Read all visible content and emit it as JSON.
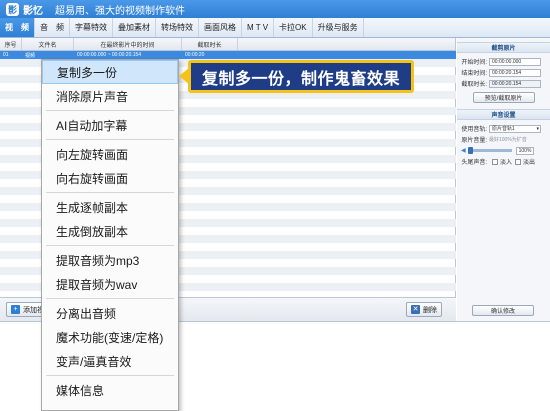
{
  "app": {
    "logo_glyph": "影",
    "name": "影忆",
    "tagline": "超易用、强大的视频制作软件"
  },
  "tabs": [
    {
      "label": "视　频",
      "active": true
    },
    {
      "label": "音　频",
      "active": false
    },
    {
      "label": "字幕特效",
      "active": false
    },
    {
      "label": "叠加素材",
      "active": false
    },
    {
      "label": "转场特效",
      "active": false
    },
    {
      "label": "画面风格",
      "active": false
    },
    {
      "label": "M T V",
      "active": false
    },
    {
      "label": "卡拉OK",
      "active": false
    },
    {
      "label": "升级与服务",
      "active": false
    }
  ],
  "table": {
    "headers": [
      "序号",
      "文件名",
      "在最终影片中的时间",
      "截取时长"
    ],
    "selected_row": {
      "index": "01",
      "name": "视频",
      "time": "00:00:00.000 ~ 00:00:20.154",
      "duration": "00:00:20"
    }
  },
  "bottombar": {
    "add_label": "添加视",
    "delete_label": "删除",
    "confirm_label": "确认修改"
  },
  "panel": {
    "clip_title": "截剪原片",
    "start_label": "开始时间:",
    "start_value": "00:00:00.000",
    "end_label": "结束时间:",
    "end_value": "00:00:20.154",
    "dur_label": "截取时长:",
    "dur_value": "00:00:20.154",
    "preview_button": "预览/截取原片",
    "audio_title": "声音设置",
    "track_label": "使用音轨:",
    "track_value": "原片音轨1",
    "volume_label": "原片音量:",
    "volume_hint": "最好100%为扩音",
    "volume_value": "100%",
    "fade_label": "头尾声音:",
    "fade_in": "淡入",
    "fade_out": "淡出"
  },
  "context_menu": {
    "groups": [
      [
        "复制多一份",
        "消除原片声音"
      ],
      [
        "AI自动加字幕"
      ],
      [
        "向左旋转画面",
        "向右旋转画面"
      ],
      [
        "生成逐帧副本",
        "生成倒放副本"
      ],
      [
        "提取音频为mp3",
        "提取音频为wav"
      ],
      [
        "分离出音频",
        "魔术功能(变速/定格)",
        "变声/逼真音效"
      ],
      [
        "媒体信息"
      ]
    ],
    "highlighted": "复制多一份"
  },
  "callout": {
    "text": "复制多一份，制作鬼畜效果"
  },
  "colors": {
    "accent": "#2f7fd6",
    "callout_bg": "#1f3d86",
    "callout_border": "#f5c218"
  }
}
